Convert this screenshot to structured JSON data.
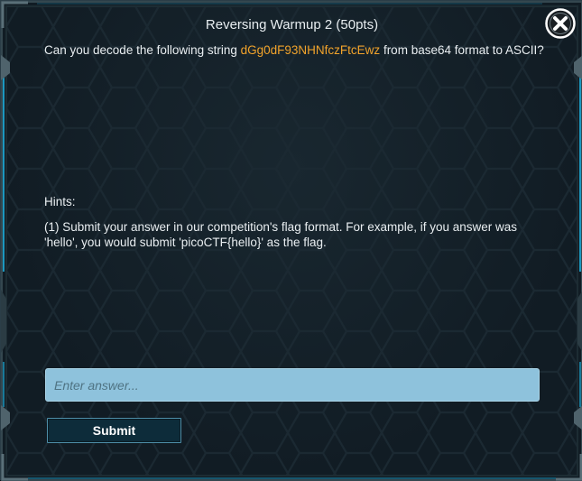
{
  "dialog": {
    "title": "Reversing Warmup 2 (50pts)",
    "question_prefix": "Can you decode the following string ",
    "question_code": "dGg0dF93NHNfczFtcEwz",
    "question_suffix": " from base64 format to ASCII?",
    "hints_heading": "Hints:",
    "hint_1": "(1) Submit your answer in our competition's flag format. For example, if you answer was 'hello', you would submit 'picoCTF{hello}' as the flag.",
    "answer_placeholder": "Enter answer...",
    "answer_value": "",
    "submit_label": "Submit",
    "close_icon": "close-circle-x"
  },
  "colors": {
    "accent_code": "#f2a32b",
    "input_bg": "#8ec2dc",
    "button_border": "#4d8ea8",
    "frame_glow": "#1fb7e8"
  }
}
